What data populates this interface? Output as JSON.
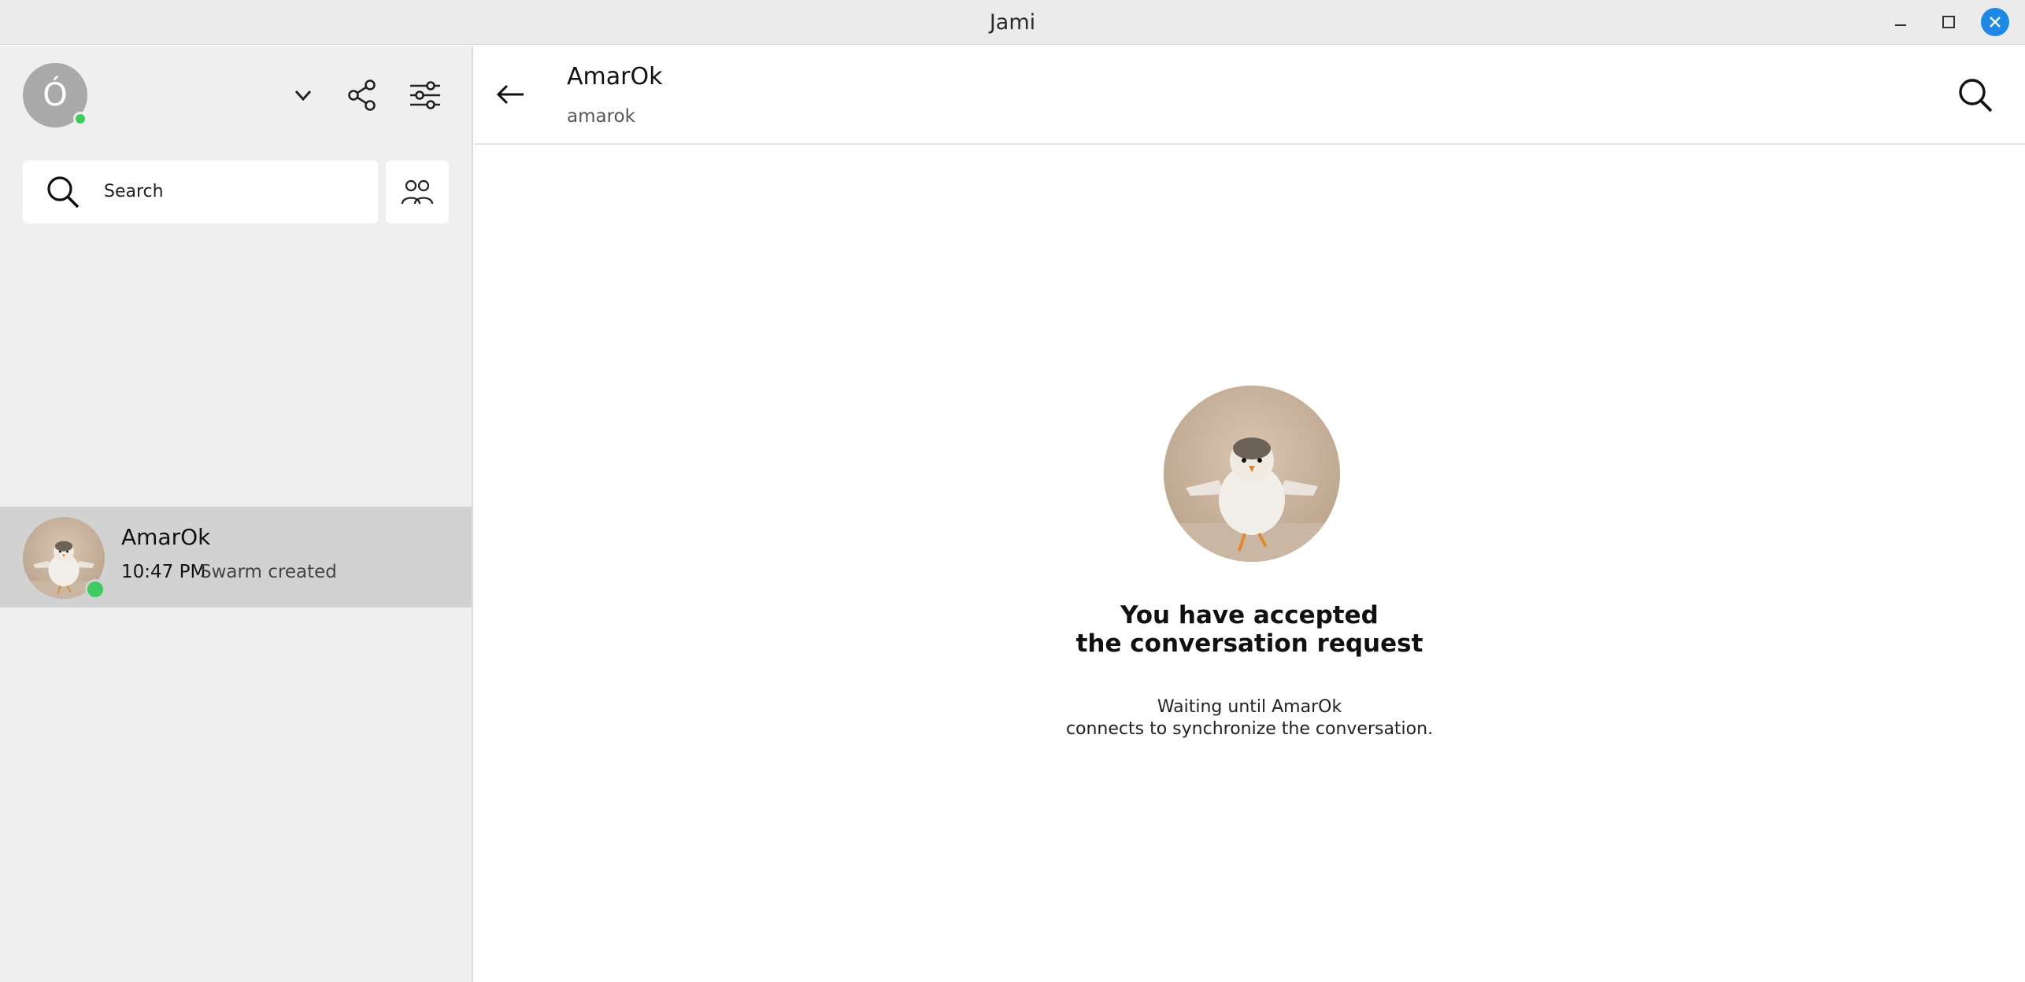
{
  "window": {
    "title": "Jami"
  },
  "account": {
    "initial": "Ó"
  },
  "search": {
    "placeholder": "Search"
  },
  "conversations": [
    {
      "name": "AmarOk",
      "time": "10:47 PM",
      "last_message": "Swarm created"
    }
  ],
  "chat": {
    "peer_name": "AmarOk",
    "peer_id": "amarok",
    "accepted_line1": "You have accepted",
    "accepted_line2": "the conversation request",
    "waiting_line1": "Waiting until AmarOk",
    "waiting_line2": "connects to synchronize the conversation."
  },
  "colors": {
    "accent": "#1e88e5",
    "online": "#3ccc5f",
    "selected_row": "#d2d2d2",
    "sidebar_bg": "#efefef"
  },
  "icons": [
    "minimize-icon",
    "maximize-icon",
    "close-icon",
    "chevron-down-icon",
    "share-icon",
    "settings-sliders-icon",
    "search-icon",
    "people-icon",
    "back-arrow-icon"
  ]
}
